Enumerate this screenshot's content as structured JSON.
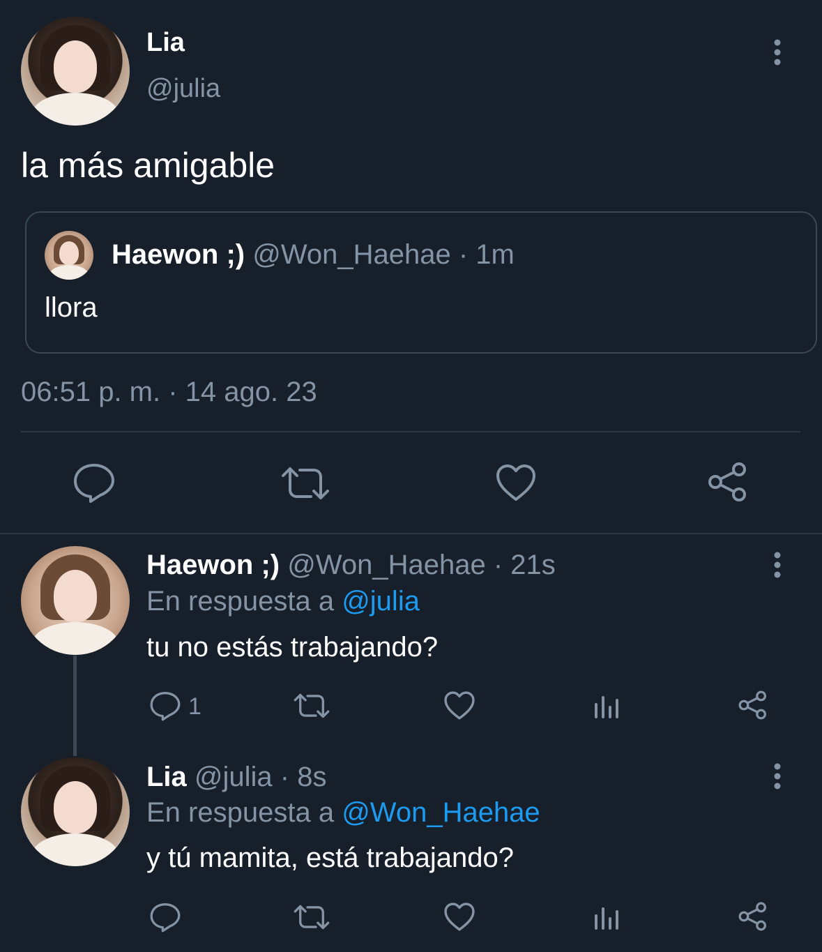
{
  "main_tweet": {
    "author_name": "Lia",
    "author_handle": "@julia",
    "text": "la más amigable",
    "quoted": {
      "author_name": "Haewon ;)",
      "meta": "@Won_Haehae · 1m",
      "text": "llora"
    },
    "timestamp": "06:51 p. m. · 14 ago. 23"
  },
  "replies": [
    {
      "author_name": "Haewon ;)",
      "meta": "@Won_Haehae · 21s",
      "reply_prefix": "En respuesta a",
      "reply_to": "@julia",
      "text": "tu no estás trabajando?",
      "reply_count": "1"
    },
    {
      "author_name": "Lia",
      "meta": "@julia · 8s",
      "reply_prefix": "En respuesta a",
      "reply_to": "@Won_Haehae",
      "text": "y tú mamita, está trabajando?",
      "reply_count": ""
    }
  ],
  "colors": {
    "background": "#161f2a",
    "muted": "#8494a5",
    "link": "#1d9bf0"
  }
}
